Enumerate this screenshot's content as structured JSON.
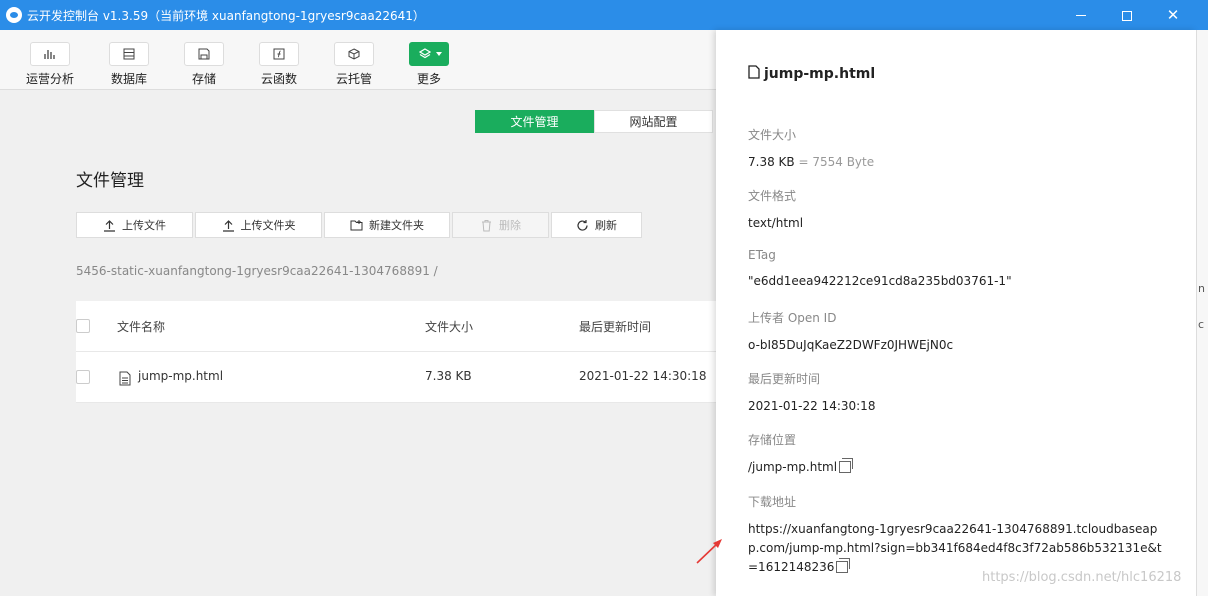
{
  "window": {
    "title": "云开发控制台 v1.3.59（当前环境 xuanfangtong-1gryesr9caa22641）",
    "minimize": "—",
    "maximize": "□",
    "close": "✕"
  },
  "toolbar": {
    "items": [
      {
        "label": "运营分析",
        "icon": "bar-chart-icon"
      },
      {
        "label": "数据库",
        "icon": "database-icon"
      },
      {
        "label": "存储",
        "icon": "storage-icon"
      },
      {
        "label": "云函数",
        "icon": "function-icon"
      },
      {
        "label": "云托管",
        "icon": "cube-icon"
      },
      {
        "label": "更多",
        "icon": "layers-icon",
        "active": true
      }
    ]
  },
  "tabs": [
    {
      "label": "文件管理",
      "active": true
    },
    {
      "label": "网站配置",
      "active": false
    }
  ],
  "page_title": "文件管理",
  "actions": {
    "upload_file": "上传文件",
    "upload_folder": "上传文件夹",
    "new_folder": "新建文件夹",
    "delete": "删除",
    "refresh": "刷新"
  },
  "path": "5456-static-xuanfangtong-1gryesr9caa22641-1304768891 /",
  "table": {
    "headers": {
      "name": "文件名称",
      "size": "文件大小",
      "time": "最后更新时间"
    },
    "rows": [
      {
        "name": "jump-mp.html",
        "size": "7.38 KB",
        "time": "2021-01-22 14:30:18"
      }
    ]
  },
  "detail": {
    "title": "jump-mp.html",
    "size_label": "文件大小",
    "size_value": "7.38 KB",
    "size_bytes": "= 7554 Byte",
    "format_label": "文件格式",
    "format_value": "text/html",
    "etag_label": "ETag",
    "etag_value": "\"e6dd1eea942212ce91cd8a235bd03761-1\"",
    "uploader_label": "上传者 Open ID",
    "uploader_value": "o-bI85DuJqKaeZ2DWFz0JHWEjN0c",
    "updated_label": "最后更新时间",
    "updated_value": "2021-01-22 14:30:18",
    "location_label": "存储位置",
    "location_value": "/jump-mp.html",
    "download_label": "下载地址",
    "download_value": "https://xuanfangtong-1gryesr9caa22641-1304768891.tcloudbaseapp.com/jump-mp.html?sign=bb341f684ed4f8c3f72ab586b532131e&t=1612148236"
  },
  "watermark": "https://blog.csdn.net/hlc16218",
  "colors": {
    "titlebar": "#2b8de8",
    "accent": "#1aad5d"
  }
}
